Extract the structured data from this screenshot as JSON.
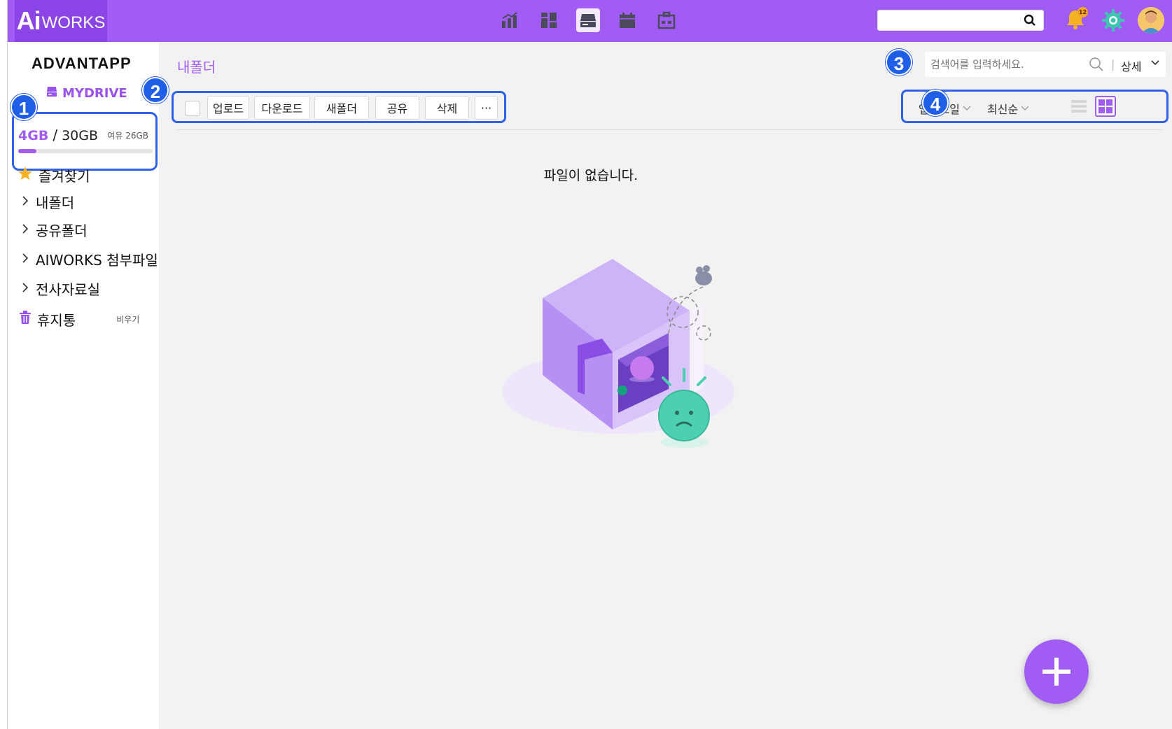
{
  "colors": {
    "brand": "#a15cf5",
    "highlight": "#2f62e9",
    "bg": "#f2f2f2"
  },
  "topbar": {
    "logo_ai": "Ai",
    "logo_works": "WORKS",
    "apps": [
      "chart-icon",
      "dashboard-icon",
      "drive-icon",
      "calendar-icon",
      "office-icon"
    ],
    "active_app": "drive-icon",
    "search_placeholder": "",
    "notification_count": "12"
  },
  "sidebar": {
    "brand": "ADVANTAPP",
    "drive_label": "MYDRIVE",
    "storage": {
      "used": "4GB",
      "slash": "/",
      "total": "30GB",
      "free": "여유 26GB",
      "used_ratio": 0.133
    },
    "favorites": "즐겨찾기",
    "tree": [
      "내폴더",
      "공유폴더",
      "AIWORKS 첨부파일",
      "전사자료실"
    ],
    "trash": "휴지통",
    "trash_empty": "비우기"
  },
  "main": {
    "folder_title": "내폴더",
    "search": {
      "placeholder": "검색어를 입력하세요.",
      "separator": "|",
      "detail": "상세"
    },
    "toolbar": {
      "upload": "업로드",
      "download": "다운로드",
      "new_folder": "새폴더",
      "share": "공유",
      "delete": "삭제",
      "more": "···"
    },
    "sort": {
      "field": "업로드일",
      "order": "최신순"
    },
    "empty_message": "파일이 없습니다."
  },
  "markers": [
    "1",
    "2",
    "3",
    "4"
  ]
}
